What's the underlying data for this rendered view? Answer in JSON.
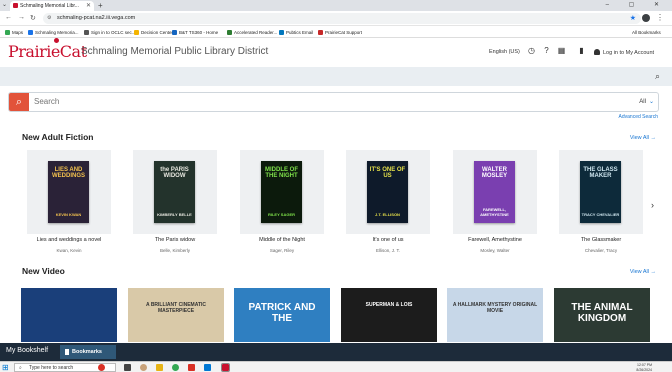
{
  "browser": {
    "tab_title": "Schmaling Memorial Libr...",
    "new_tab": "+",
    "url": "schmaling-pcat.na2.iii.vega.com",
    "window_controls": "– ▢ ✕",
    "bookmarks": [
      {
        "label": "Maps",
        "color": "#34a853"
      },
      {
        "label": "Schmaling Memoria...",
        "color": "#1a73e8"
      },
      {
        "label": "Sign in to OCLC sec...",
        "color": "#555555"
      },
      {
        "label": "Decision Center",
        "color": "#f4b400"
      },
      {
        "label": "B&T TS360 - Home",
        "color": "#1565c0"
      },
      {
        "label": "Accelerated Reader...",
        "color": "#2e7d32"
      },
      {
        "label": "Pubtics Email",
        "color": "#0277bd"
      },
      {
        "label": "PrairieCat Support",
        "color": "#c62828"
      }
    ],
    "all_bookmarks": "All Bookmarks"
  },
  "site": {
    "logo_text": "PrairieCat",
    "library_name": "Schmaling Memorial Public Library District",
    "language": "English (US)",
    "login": "Log in to My Account",
    "brand_color": "#c8102e",
    "accent_color": "#e2533a",
    "link_color": "#1976d2"
  },
  "search": {
    "placeholder": "Search",
    "scope": "All",
    "advanced": "Advanced Search"
  },
  "sections": {
    "fiction_title": "New Adult Fiction",
    "video_title": "New Video",
    "view_all": "View All →"
  },
  "books": [
    {
      "title": "Lies and weddings a novel",
      "author": "Kwan, Kevin",
      "cover_title": "LIES AND WEDDINGS",
      "cover_author": "KEVIN KWAN",
      "bg": "#2a2237",
      "fg": "#f2c14e"
    },
    {
      "title": "The Paris widow",
      "author": "Belle, Kimberly",
      "cover_title": "the PARIS WIDOW",
      "cover_author": "KIMBERLY BELLE",
      "bg": "#23332c",
      "fg": "#e8e8e0"
    },
    {
      "title": "Middle of the Night",
      "author": "Sager, Riley",
      "cover_title": "MIDDLE OF THE NIGHT",
      "cover_author": "RILEY SAGER",
      "bg": "#0c1a0c",
      "fg": "#7ee04a"
    },
    {
      "title": "It's one of us",
      "author": "Ellison, J. T.",
      "cover_title": "IT'S ONE OF US",
      "cover_author": "J.T. ELLISON",
      "bg": "#0e1a2a",
      "fg": "#e6e14a"
    },
    {
      "title": "Farewell, Amethystine",
      "author": "Mosley, Walter",
      "cover_title": "WALTER MOSLEY",
      "cover_author": "FAREWELL, AMETHYSTINE",
      "bg": "#7a3fb0",
      "fg": "#ffffff"
    },
    {
      "title": "The Glassmaker",
      "author": "Chevalier, Tracy",
      "cover_title": "THE GLASS MAKER",
      "cover_author": "TRACY CHEVALIER",
      "bg": "#0d2a3a",
      "fg": "#cfe6ef"
    }
  ],
  "videos": [
    {
      "label": "",
      "bg": "#1a3f7a"
    },
    {
      "label": "A BRILLIANT CINEMATIC MASTERPIECE",
      "bg": "#d9c9a8"
    },
    {
      "label": "PATRICK AND THE",
      "bg": "#2f7fc1"
    },
    {
      "label": "SUPERMAN & LOIS",
      "bg": "#1c1c1c"
    },
    {
      "label": "A HALLMARK MYSTERY ORIGINAL MOVIE",
      "bg": "#c7d7e8"
    },
    {
      "label": "THE ANIMAL KINGDOM",
      "bg": "#2c3a33"
    }
  ],
  "bookshelf": {
    "label": "My Bookshelf",
    "bookmarks": "Bookmarks"
  },
  "taskbar": {
    "search_placeholder": "Type here to search",
    "time": "12:07 PM",
    "date": "8/26/2024"
  }
}
